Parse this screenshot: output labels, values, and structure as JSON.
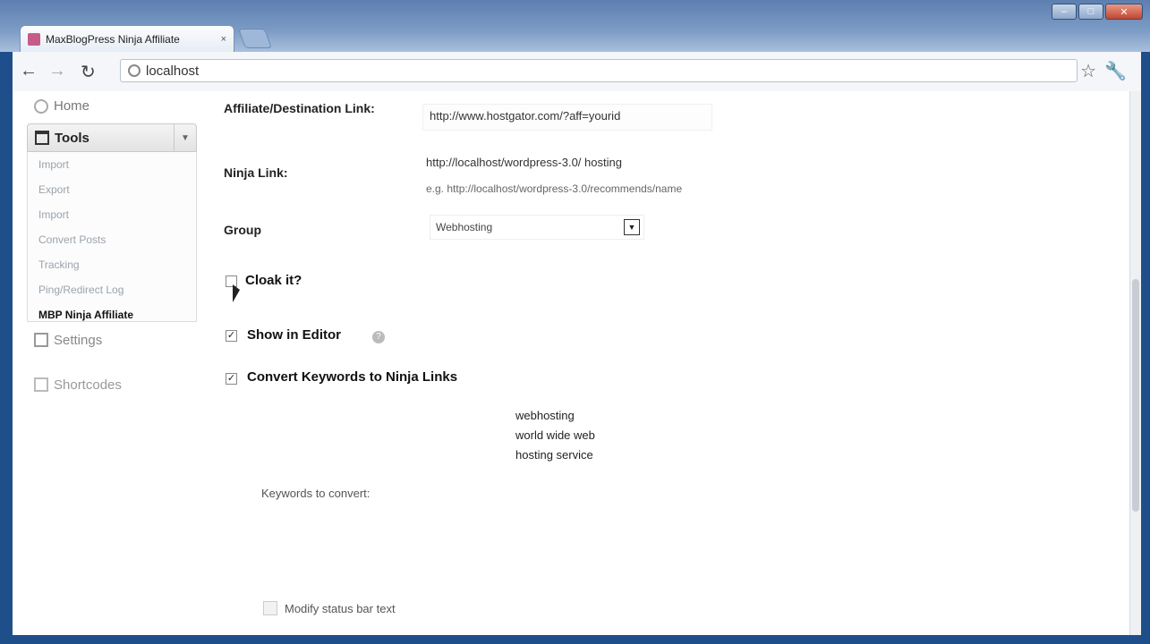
{
  "browser": {
    "tab_title": "MaxBlogPress Ninja Affiliate",
    "tab_close": "×",
    "url": "localhost",
    "window_controls": [
      "–",
      "□",
      "✕"
    ]
  },
  "sidebar": {
    "home_label": "Home",
    "tools_label": "Tools",
    "tools_items": [
      "Import",
      "Export",
      "Import",
      "Convert Posts",
      "Tracking",
      "Ping/Redirect Log",
      "MBP Ninja Affiliate"
    ],
    "settings_label": "Settings",
    "secondary_label": "Shortcodes"
  },
  "form": {
    "affiliate_label": "Affiliate/Destination Link:",
    "affiliate_value": "http://www.hostgator.com/?aff=yourid",
    "ninja_label": "Ninja Link:",
    "ninja_value": "http://localhost/wordpress-3.0/ hosting",
    "ninja_hint": "e.g. http://localhost/wordpress-3.0/recommends/name",
    "group_label": "Group",
    "group_value": "Webhosting",
    "cloak_label": "Cloak it?",
    "show_editor_label": "Show in Editor",
    "convert_label": "Convert Keywords to Ninja Links",
    "keywords": [
      "webhosting",
      "world wide web",
      "hosting service"
    ],
    "keywords_label": "Keywords to convert:",
    "status_label": "Modify status bar text"
  },
  "colors": {
    "window_frame": "#1f4f8a",
    "current_item": "#111111"
  }
}
